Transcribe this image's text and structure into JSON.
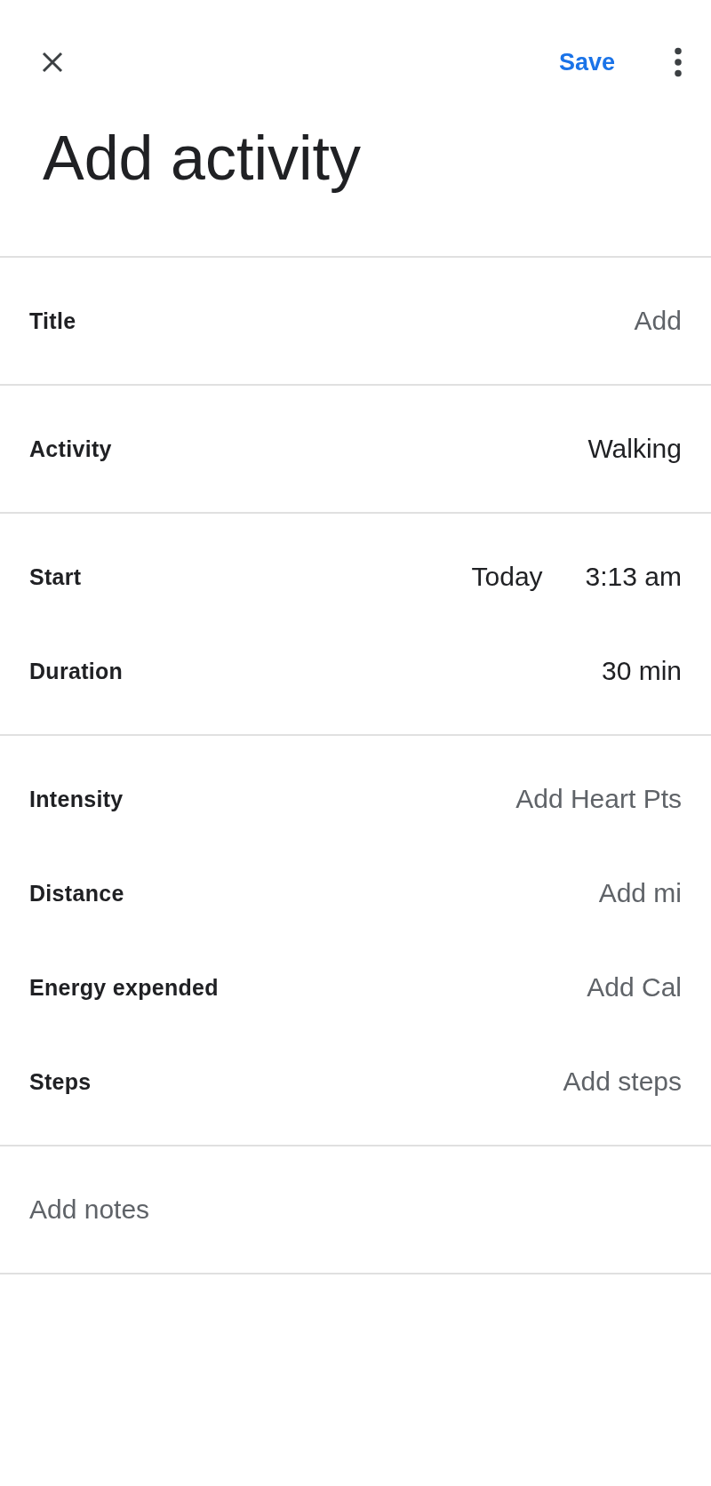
{
  "top_bar": {
    "save": "Save"
  },
  "title": "Add activity",
  "sections": [
    {
      "rows": [
        {
          "label": "Title",
          "placeholder": "Add"
        }
      ]
    },
    {
      "rows": [
        {
          "label": "Activity",
          "values": [
            "Walking"
          ]
        }
      ]
    },
    {
      "rows": [
        {
          "label": "Start",
          "values": [
            "Today",
            "3:13 am"
          ]
        },
        {
          "label": "Duration",
          "values": [
            "30 min"
          ]
        }
      ]
    },
    {
      "rows": [
        {
          "label": "Intensity",
          "placeholder": "Add Heart Pts"
        },
        {
          "label": "Distance",
          "placeholder": "Add mi"
        },
        {
          "label": "Energy expended",
          "placeholder": "Add Cal"
        },
        {
          "label": "Steps",
          "placeholder": "Add steps"
        }
      ]
    }
  ],
  "notes": {
    "placeholder": "Add notes"
  }
}
